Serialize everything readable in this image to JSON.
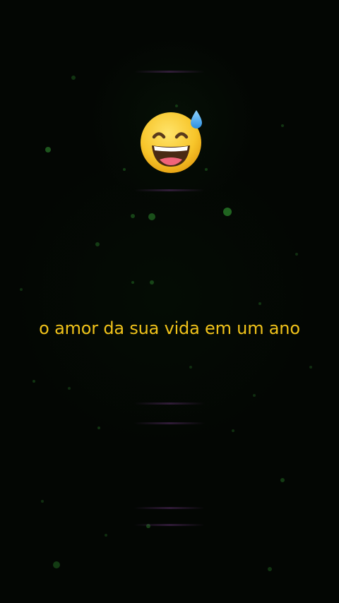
{
  "video": {
    "caption": "o amor da sua vida em um ano",
    "emoji_name": "grinning-face-with-sweat-icon",
    "caption_color": "#f0c21a",
    "particle_color": "#2e8b2e",
    "background_color": "#030603"
  }
}
